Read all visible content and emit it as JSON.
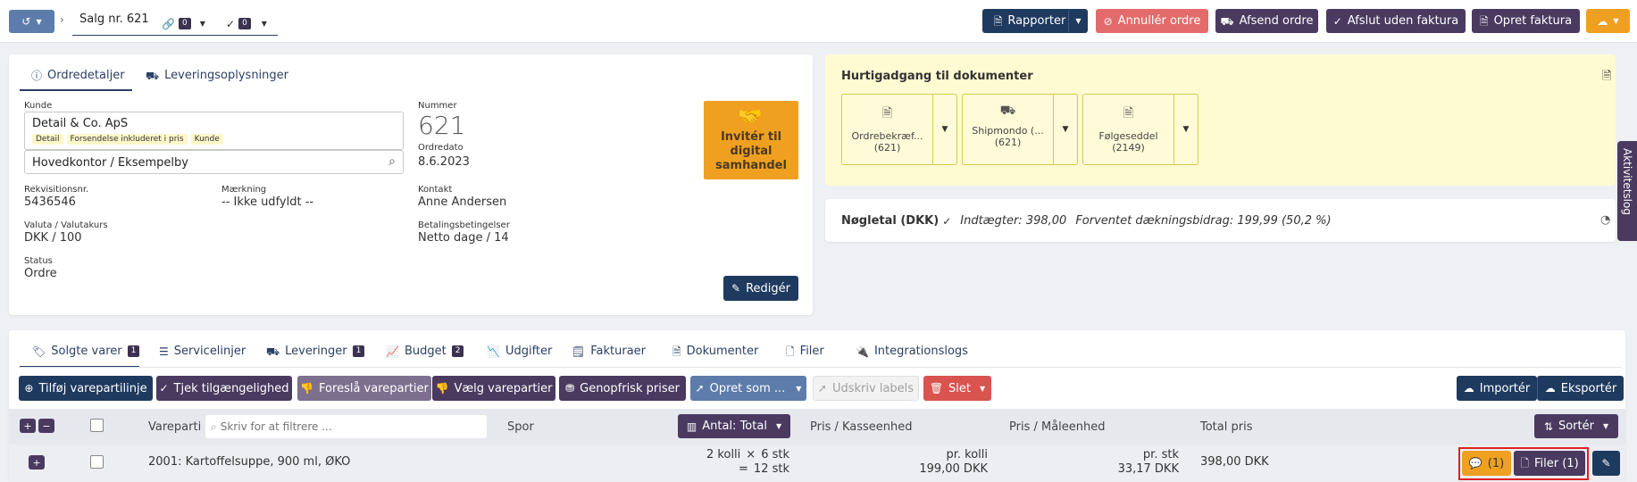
{
  "topbar": {
    "order_title": "Salg nr. 621",
    "link_count": "0",
    "check_count": "0",
    "buttons": {
      "reports": "Rapporter",
      "cancel_order": "Annullér ordre",
      "send_order": "Afsend ordre",
      "finish_no_invoice": "Afslut uden faktura",
      "create_invoice": "Opret faktura"
    }
  },
  "order_tabs": {
    "details": "Ordredetaljer",
    "delivery": "Leveringsoplysninger"
  },
  "order": {
    "customer_label": "Kunde",
    "customer_name": "Detail & Co. ApS",
    "customer_tags": [
      "Detail",
      "Forsendelse inkluderet i pris",
      "Kunde"
    ],
    "address": "Hovedkontor / Eksempelby",
    "number_label": "Nummer",
    "number": "621",
    "date_label": "Ordredato",
    "date": "8.6.2023",
    "requisition_label": "Rekvisitionsnr.",
    "requisition": "5436546",
    "marking_label": "Mærkning",
    "marking": "-- Ikke udfyldt --",
    "contact_label": "Kontakt",
    "contact": "Anne Andersen",
    "currency_label": "Valuta / Valutakurs",
    "currency": "DKK / 100",
    "payment_label": "Betalingsbetingelser",
    "payment": "Netto dage / 14",
    "status_label": "Status",
    "status": "Ordre",
    "invite_text": "Invitér til digital samhandel",
    "edit_button": "Redigér"
  },
  "quick_docs": {
    "title": "Hurtigadgang til dokumenter",
    "docs": [
      {
        "name": "Ordrebekræf...",
        "number": "(621)"
      },
      {
        "name": "Shipmondo (...",
        "number": "(621)"
      },
      {
        "name": "Følgeseddel",
        "number": "(2149)"
      }
    ]
  },
  "kpi": {
    "title": "Nøgletal (DKK)",
    "income": "Indtægter: 398,00",
    "margin": "Forventet dækningsbidrag: 199,99 (50,2 %)"
  },
  "side_tab": "Aktivitetslog",
  "lines_tabs": [
    {
      "label": "Solgte varer",
      "badge": "1"
    },
    {
      "label": "Servicelinjer",
      "badge": ""
    },
    {
      "label": "Leveringer",
      "badge": "1"
    },
    {
      "label": "Budget",
      "badge": "2"
    },
    {
      "label": "Udgifter",
      "badge": ""
    },
    {
      "label": "Fakturaer",
      "badge": ""
    },
    {
      "label": "Dokumenter",
      "badge": ""
    },
    {
      "label": "Filer",
      "badge": ""
    },
    {
      "label": "Integrationslogs",
      "badge": ""
    }
  ],
  "toolbar": {
    "add_line": "Tilføj varepartilinje",
    "check_availability": "Tjek tilgængelighed",
    "suggest_lots": "Foreslå varepartier",
    "choose_lots": "Vælg varepartier",
    "refresh_prices": "Genopfrisk priser",
    "create_as": "Opret som ...",
    "print_labels": "Udskriv labels",
    "delete": "Slet",
    "import": "Importér",
    "export": "Eksportér"
  },
  "table": {
    "headers": {
      "lot": "Vareparti",
      "filter_placeholder": "Skriv for at filtrere ...",
      "track": "Spor",
      "quantity": "Antal: Total",
      "price_case": "Pris / Kasseenhed",
      "price_unit": "Pris / Måleenhed",
      "total_price": "Total pris",
      "sort": "Sortér"
    },
    "row": {
      "name": "2001: Kartoffelsuppe, 900 ml, ØKO",
      "qty_line1": "2 kolli",
      "qty_x": "×",
      "qty_line1b": "6 stk",
      "qty_eq": "=",
      "qty_line2": "12 stk",
      "price_case_unit": "pr. kolli",
      "price_case_value": "199,00 DKK",
      "price_unit_unit": "pr. stk",
      "price_unit_value": "33,17 DKK",
      "total": "398,00 DKK",
      "comments": "(1)",
      "files": "Filer (1)"
    }
  },
  "colors": {
    "navy": "#1f3a5f",
    "purple": "#4a3a60",
    "orange": "#f0a020",
    "red": "#d9534f",
    "highlight": "#e02020"
  }
}
